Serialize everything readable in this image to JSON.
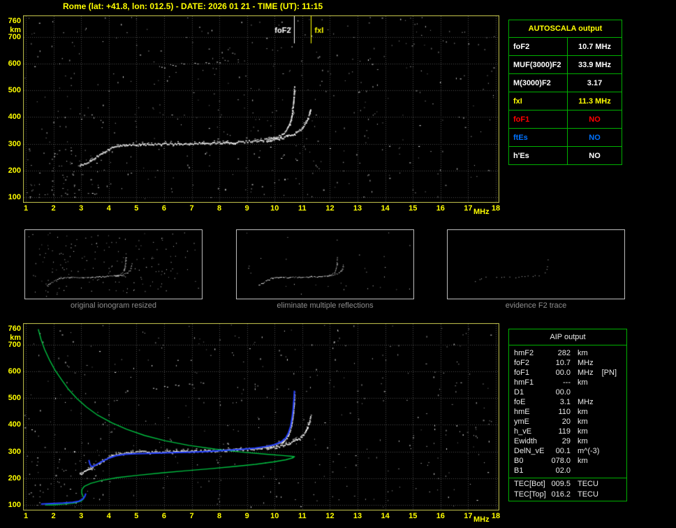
{
  "title": "Rome (lat: +41.8, lon: 012.5) - DATE: 2026 01 21 - TIME (UT): 11:15",
  "colors": {
    "background": "#000000",
    "frame": "#c9c94e",
    "grid": "#4c4c4c",
    "table_border": "#00b000",
    "title_text": "#ffff00",
    "body_text": "#ffffff",
    "caption_text": "#8f8f8f",
    "o_trace": "#ffffff",
    "restored_trace": "#2440ff",
    "profile": "#00c040",
    "foF1_color": "#ff0000",
    "ftEs_color": "#0072ff"
  },
  "autoscala_table": {
    "title": "AUTOSCALA output",
    "rows": [
      {
        "label": "foF2",
        "value": "10.7 MHz",
        "color": "#ffffff"
      },
      {
        "label": "MUF(3000)F2",
        "value": "33.9 MHz",
        "color": "#ffffff"
      },
      {
        "label": "M(3000)F2",
        "value": "3.17",
        "color": "#ffffff"
      },
      {
        "label": "fxI",
        "value": "11.3 MHz",
        "color": "#ffff00"
      },
      {
        "label": "foF1",
        "value": "NO",
        "color": "#ff0000"
      },
      {
        "label": "ftEs",
        "value": "NO",
        "color": "#0072ff"
      },
      {
        "label": "h'Es",
        "value": "NO",
        "color": "#ffffff"
      }
    ]
  },
  "thumbnails": [
    {
      "caption": "original ionogram resized"
    },
    {
      "caption": "eliminate multiple reflections"
    },
    {
      "caption": "evidence F2 trace"
    }
  ],
  "aip_table": {
    "title": "AIP output",
    "rows": [
      {
        "label": "hmF2",
        "value": "282",
        "unit": "km"
      },
      {
        "label": "foF2",
        "value": "10.7",
        "unit": "MHz"
      },
      {
        "label": "foF1",
        "value": "00.0",
        "unit": "MHz",
        "note": "[PN]"
      },
      {
        "label": "hmF1",
        "value": "---",
        "unit": "km"
      },
      {
        "label": "D1",
        "value": "00.0",
        "unit": ""
      },
      {
        "label": "foE",
        "value": "3.1",
        "unit": "MHz"
      },
      {
        "label": "hmE",
        "value": "110",
        "unit": "km"
      },
      {
        "label": "ymE",
        "value": "20",
        "unit": "km"
      },
      {
        "label": "h_vE",
        "value": "119",
        "unit": "km"
      },
      {
        "label": "Ewidth",
        "value": "29",
        "unit": "km"
      },
      {
        "label": "DelN_vE",
        "value": "00.1",
        "unit": "m^(-3)"
      },
      {
        "label": "B0",
        "value": "078.0",
        "unit": "km"
      },
      {
        "label": "B1",
        "value": "02.0",
        "unit": ""
      }
    ],
    "tec_rows": [
      {
        "label": "TEC[Bot]",
        "value": "009.5",
        "unit": "TECU"
      },
      {
        "label": "TEC[Top]",
        "value": "016.2",
        "unit": "TECU"
      }
    ]
  },
  "chart_data": [
    {
      "type": "scatter",
      "title": "scaled ionogram with AUTOSCALA markers",
      "xlabel": "MHz",
      "ylabel": "km",
      "xlim": [
        1,
        18
      ],
      "ylim": [
        100,
        760
      ],
      "grid": true,
      "xticks": [
        1,
        2,
        3,
        4,
        5,
        6,
        7,
        8,
        9,
        10,
        11,
        12,
        13,
        14,
        15,
        16,
        17,
        18
      ],
      "yticks": [
        100,
        200,
        300,
        400,
        500,
        600,
        700,
        760
      ],
      "annotations": [
        {
          "label": "foF2",
          "x": 10.7,
          "color": "#ffffff",
          "align": "right"
        },
        {
          "label": "fxI",
          "x": 11.3,
          "color": "#ffff00",
          "align": "left"
        }
      ],
      "series": [
        {
          "name": "O-mode trace",
          "style": "trace",
          "color": "#ffffff",
          "points": [
            [
              2.95,
              218
            ],
            [
              3.05,
              224
            ],
            [
              3.2,
              232
            ],
            [
              3.35,
              241
            ],
            [
              3.5,
              250
            ],
            [
              3.65,
              259
            ],
            [
              3.8,
              268
            ],
            [
              3.95,
              278
            ],
            [
              4.1,
              287
            ],
            [
              4.3,
              293
            ],
            [
              4.55,
              297
            ],
            [
              4.85,
              299
            ],
            [
              5.2,
              300
            ],
            [
              5.6,
              300
            ],
            [
              6.1,
              301
            ],
            [
              6.6,
              302
            ],
            [
              7.2,
              303
            ],
            [
              7.8,
              305
            ],
            [
              8.4,
              307
            ],
            [
              9.0,
              310
            ],
            [
              9.4,
              314
            ],
            [
              9.8,
              320
            ],
            [
              10.05,
              327
            ],
            [
              10.25,
              337
            ],
            [
              10.4,
              350
            ],
            [
              10.5,
              368
            ],
            [
              10.57,
              390
            ],
            [
              10.62,
              418
            ],
            [
              10.66,
              450
            ],
            [
              10.685,
              482
            ],
            [
              10.7,
              512
            ]
          ]
        },
        {
          "name": "X-mode trace",
          "style": "trace",
          "color": "#ffffff",
          "points": [
            [
              9.7,
              311
            ],
            [
              10.0,
              317
            ],
            [
              10.3,
              325
            ],
            [
              10.6,
              336
            ],
            [
              10.85,
              349
            ],
            [
              11.0,
              362
            ],
            [
              11.1,
              377
            ],
            [
              11.18,
              394
            ],
            [
              11.24,
              412
            ],
            [
              11.28,
              430
            ]
          ]
        },
        {
          "name": "second reflection",
          "style": "dots",
          "color": "#e0e0e0",
          "points": [
            [
              5.9,
              588
            ],
            [
              6.3,
              595
            ],
            [
              6.7,
              600
            ],
            [
              7.1,
              603
            ],
            [
              7.5,
              605
            ],
            [
              7.9,
              607
            ]
          ]
        }
      ]
    },
    {
      "type": "scatter",
      "title": "ionogram with restored trace and electron density profile",
      "xlabel": "MHz",
      "ylabel": "km",
      "xlim": [
        1,
        18
      ],
      "ylim": [
        100,
        760
      ],
      "grid": true,
      "xticks": [
        1,
        2,
        3,
        4,
        5,
        6,
        7,
        8,
        9,
        10,
        11,
        12,
        13,
        14,
        15,
        16,
        17,
        18
      ],
      "yticks": [
        100,
        200,
        300,
        400,
        500,
        600,
        700,
        760
      ],
      "series": [
        {
          "name": "O-mode trace",
          "style": "trace",
          "color": "#ffffff",
          "points": [
            [
              2.95,
              218
            ],
            [
              3.05,
              224
            ],
            [
              3.2,
              232
            ],
            [
              3.35,
              241
            ],
            [
              3.5,
              250
            ],
            [
              3.65,
              259
            ],
            [
              3.8,
              268
            ],
            [
              3.95,
              278
            ],
            [
              4.1,
              287
            ],
            [
              4.3,
              293
            ],
            [
              4.55,
              297
            ],
            [
              4.85,
              299
            ],
            [
              5.2,
              300
            ],
            [
              5.6,
              300
            ],
            [
              6.1,
              301
            ],
            [
              6.6,
              302
            ],
            [
              7.2,
              303
            ],
            [
              7.8,
              305
            ],
            [
              8.4,
              307
            ],
            [
              9.0,
              310
            ],
            [
              9.4,
              314
            ],
            [
              9.8,
              320
            ],
            [
              10.05,
              327
            ],
            [
              10.25,
              337
            ],
            [
              10.4,
              350
            ],
            [
              10.5,
              368
            ],
            [
              10.57,
              390
            ],
            [
              10.62,
              418
            ],
            [
              10.66,
              450
            ],
            [
              10.685,
              482
            ],
            [
              10.7,
              512
            ]
          ]
        },
        {
          "name": "X-mode trace",
          "style": "trace",
          "color": "#ffffff",
          "points": [
            [
              9.7,
              311
            ],
            [
              10.0,
              317
            ],
            [
              10.3,
              325
            ],
            [
              10.6,
              336
            ],
            [
              10.85,
              349
            ],
            [
              11.0,
              362
            ],
            [
              11.1,
              377
            ],
            [
              11.18,
              394
            ],
            [
              11.24,
              412
            ],
            [
              11.28,
              430
            ]
          ]
        },
        {
          "name": "second reflection",
          "style": "dots",
          "color": "#e0e0e0",
          "points": [
            [
              5.6,
              538
            ],
            [
              6.0,
              545
            ],
            [
              6.4,
              550
            ],
            [
              6.9,
              554
            ],
            [
              7.4,
              557
            ]
          ]
        },
        {
          "name": "electron density profile",
          "style": "line",
          "color": "#00c040",
          "width": 1.4,
          "points": [
            [
              1.45,
              758
            ],
            [
              1.55,
              720
            ],
            [
              1.68,
              682
            ],
            [
              1.85,
              644
            ],
            [
              2.05,
              606
            ],
            [
              2.3,
              568
            ],
            [
              2.55,
              532
            ],
            [
              2.85,
              498
            ],
            [
              3.2,
              466
            ],
            [
              3.6,
              436
            ],
            [
              4.1,
              408
            ],
            [
              4.65,
              383
            ],
            [
              5.3,
              360
            ],
            [
              6.05,
              340
            ],
            [
              6.9,
              323
            ],
            [
              7.85,
              309
            ],
            [
              8.8,
              298
            ],
            [
              9.7,
              290
            ],
            [
              10.3,
              285
            ],
            [
              10.62,
              282
            ],
            [
              10.72,
              281
            ],
            [
              10.65,
              276
            ],
            [
              10.4,
              269
            ],
            [
              9.95,
              261
            ],
            [
              9.3,
              252
            ],
            [
              8.55,
              244
            ],
            [
              7.7,
              236
            ],
            [
              6.8,
              228
            ],
            [
              5.9,
              220
            ],
            [
              5.05,
              211
            ],
            [
              4.3,
              202
            ],
            [
              3.75,
              192
            ],
            [
              3.35,
              181
            ],
            [
              3.12,
              170
            ],
            [
              3.03,
              158
            ],
            [
              3.02,
              146
            ],
            [
              3.06,
              134
            ],
            [
              3.1,
              124
            ],
            [
              3.0,
              114
            ],
            [
              2.75,
              107
            ],
            [
              2.4,
              103
            ],
            [
              2.0,
              100
            ],
            [
              1.7,
              100
            ]
          ]
        },
        {
          "name": "restored F trace (AIP)",
          "style": "line",
          "color": "#2440ff",
          "width": 2,
          "points": [
            [
              3.28,
              268
            ],
            [
              3.32,
              252
            ],
            [
              3.38,
              243
            ],
            [
              3.5,
              248
            ],
            [
              3.65,
              257
            ],
            [
              3.82,
              266
            ],
            [
              4.0,
              275
            ],
            [
              4.25,
              284
            ],
            [
              4.6,
              290
            ],
            [
              5.0,
              292
            ],
            [
              5.5,
              293
            ],
            [
              6.1,
              295
            ],
            [
              6.8,
              297
            ],
            [
              7.5,
              300
            ],
            [
              8.2,
              304
            ],
            [
              8.8,
              308
            ],
            [
              9.3,
              313
            ],
            [
              9.7,
              319
            ],
            [
              10.0,
              326
            ],
            [
              10.25,
              337
            ],
            [
              10.4,
              351
            ],
            [
              10.5,
              370
            ],
            [
              10.58,
              396
            ],
            [
              10.63,
              426
            ],
            [
              10.67,
              460
            ],
            [
              10.7,
              498
            ],
            [
              10.715,
              528
            ]
          ]
        },
        {
          "name": "restored E trace (AIP)",
          "style": "line",
          "color": "#2440ff",
          "width": 2,
          "points": [
            [
              1.55,
              103
            ],
            [
              1.95,
              105
            ],
            [
              2.35,
              107
            ],
            [
              2.7,
              110
            ],
            [
              2.92,
              114
            ],
            [
              3.05,
              121
            ],
            [
              3.13,
              131
            ],
            [
              3.17,
              143
            ]
          ]
        }
      ]
    }
  ]
}
